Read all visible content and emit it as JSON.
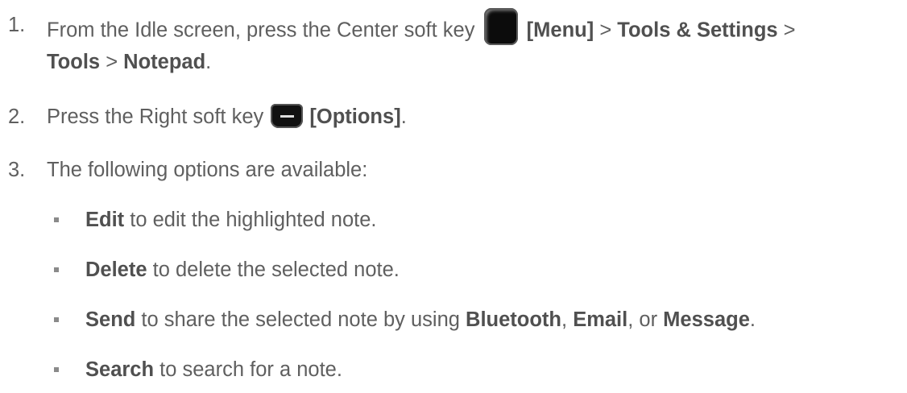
{
  "steps": [
    {
      "num": "1.",
      "t1": "From the Idle screen, press the Center soft key ",
      "icon": "center-soft-key-icon",
      "b1": "[Menu]",
      "t2": " > ",
      "b2": "Tools & Settings",
      "t3": " >",
      "b3": "Tools",
      "t4": " > ",
      "b4": "Notepad",
      "t5": "."
    },
    {
      "num": "2.",
      "t1": "Press the Right soft key ",
      "icon": "right-soft-key-icon",
      "b1": "[Options]",
      "t2": "."
    },
    {
      "num": "3.",
      "t1": "The following options are available:"
    }
  ],
  "options": [
    {
      "b": "Edit",
      "t": " to edit the highlighted note."
    },
    {
      "b": "Delete",
      "t": " to delete the selected note."
    },
    {
      "b": "Send",
      "t": " to share the selected note by using ",
      "b2": "Bluetooth",
      "t2": ", ",
      "b3": "Email",
      "t3": ", or ",
      "b4": "Message",
      "t4": "."
    },
    {
      "b": "Search",
      "t": " to search for a note."
    }
  ]
}
